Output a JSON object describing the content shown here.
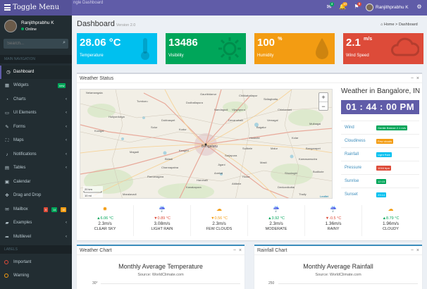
{
  "header": {
    "brand": "Toggle Menu",
    "tab_title": "ngle Dashboard",
    "notifications": [
      {
        "icon": "envelope-icon",
        "count": "4",
        "color": "#00a65a"
      },
      {
        "icon": "bell-icon",
        "count": "10",
        "color": "#f39c12"
      },
      {
        "icon": "flag-icon",
        "count": "9",
        "color": "#dd4b39"
      }
    ],
    "user_name": "Ranjithprabhu K",
    "settings_icon": "gears-icon"
  },
  "sidebar": {
    "user_name": "Ranjithprabhu K",
    "status": "Online",
    "search_placeholder": "Search...",
    "nav_header": "MAIN NAVIGATION",
    "items": [
      {
        "label": "Dashboard",
        "icon": "dashboard-icon",
        "active": true
      },
      {
        "label": "Widgets",
        "icon": "th-icon",
        "badge": "new",
        "badge_color": "#00a65a"
      },
      {
        "label": "Charts",
        "icon": "pie-chart-icon"
      },
      {
        "label": "UI Elements",
        "icon": "laptop-icon"
      },
      {
        "label": "Forms",
        "icon": "edit-icon"
      },
      {
        "label": "Maps",
        "icon": "map-icon"
      },
      {
        "label": "Notifications",
        "icon": "bell-icon"
      },
      {
        "label": "Tables",
        "icon": "table-icon"
      },
      {
        "label": "Calendar",
        "icon": "calendar-icon"
      },
      {
        "label": "Drag and Drop",
        "icon": "drag-icon"
      },
      {
        "label": "Mailbox",
        "icon": "envelope-icon",
        "badges": [
          {
            "text": "5",
            "color": "#dd4b39"
          },
          {
            "text": "14",
            "color": "#00a65a"
          },
          {
            "text": "16",
            "color": "#f39c12"
          }
        ]
      },
      {
        "label": "Examples",
        "icon": "folder-icon"
      },
      {
        "label": "Multilevel",
        "icon": "share-icon"
      }
    ],
    "labels_header": "LABELS",
    "labels": [
      {
        "label": "Important",
        "color": "#dd4b39"
      },
      {
        "label": "Warning",
        "color": "#f39c12"
      }
    ]
  },
  "page": {
    "title": "Dashboard",
    "version": "Version 2.0",
    "breadcrumb_home": "Home",
    "breadcrumb_current": "Dashboard"
  },
  "tiles": [
    {
      "value": "28.06 °C",
      "label": "Temperature",
      "color": "#00c0ef",
      "icon": "thermometer-icon"
    },
    {
      "value": "13486",
      "label": "Visibility",
      "color": "#00a65a",
      "icon": "sun-icon"
    },
    {
      "value": "100",
      "unit": "%",
      "label": "Humidity",
      "color": "#f39c12",
      "icon": "drop-icon"
    },
    {
      "value": "2.1",
      "unit": "m/s",
      "label": "Wind Speed",
      "color": "#dd4b39",
      "icon": "cloud-icon"
    }
  ],
  "weather": {
    "box_title": "Weather Status",
    "location_title": "Weather in Bangalore, IN",
    "time": "01 : 44 : 00 PM",
    "rows": [
      {
        "key": "Wind",
        "value": "Gentle Breeze 2.1 m/s",
        "color": "#00a65a"
      },
      {
        "key": "Cloudiness",
        "value": "Few clouds",
        "color": "#f39c12"
      },
      {
        "key": "Rainfall",
        "value": "Light Rain",
        "color": "#00c0ef"
      },
      {
        "key": "Pressure",
        "value": "1016 hpa",
        "color": "#dd4b39"
      },
      {
        "key": "Sunrise",
        "value": "12:15",
        "color": "#00a65a"
      },
      {
        "key": "Sunset",
        "value": "23:14",
        "color": "#00c0ef"
      }
    ],
    "map": {
      "city": "Bengaluru",
      "scale_km": "20 km",
      "scale_mi": "10 mi",
      "attribution": "Leaflet",
      "places": [
        "Nelamangala",
        "Tumkuru",
        "Dodballapura",
        "Devanahalli",
        "Hoskote",
        "Kolar",
        "Magadi",
        "Ramanagara",
        "Kanakapura",
        "Anekal",
        "Hosur",
        "Malur",
        "Bangarapet",
        "Chintamani",
        "Sarjapura",
        "Bidadi",
        "Kunigal",
        "Channapatna",
        "Denkanikottai",
        "Thally",
        "Vijayapura",
        "Sidlaghatta",
        "Gauribidanur",
        "Mulbagal",
        "Kengeri",
        "Jigani",
        "Attibele",
        "Solur",
        "Huliyurdurga",
        "Dobbaspet",
        "Kudur",
        "Chikkaballapur",
        "Vemagal",
        "Masti",
        "Sulibele",
        "Nandagudi",
        "Harohalli",
        "Maralavadi",
        "Bagalur",
        "Shoolagiri",
        "Kamasamudra",
        "Budikote"
      ]
    },
    "forecast": [
      {
        "icon": "sun-icon",
        "icon_color": "#f39c12",
        "temp": "▲6.06 °C",
        "temp_color": "#00a65a",
        "wind": "2.3m/s",
        "cond": "CLEAR SKY"
      },
      {
        "icon": "rain-icon",
        "icon_color": "#3c8dbc",
        "temp": "▼0.89 °C",
        "temp_color": "#dd4b39",
        "wind": "3.08m/s",
        "cond": "LIGHT RAIN"
      },
      {
        "icon": "cloud-icon",
        "icon_color": "#f39c12",
        "temp": "▼0.56 °C",
        "temp_color": "#f39c12",
        "wind": "2.3m/s",
        "cond": "FEW CLOUDS"
      },
      {
        "icon": "rain-icon",
        "icon_color": "#dd4b39",
        "temp": "▲3.92 °C",
        "temp_color": "#00a65a",
        "wind": "2.3m/s",
        "cond": "MODERATE"
      },
      {
        "icon": "rain-icon",
        "icon_color": "#3c8dbc",
        "temp": "▼-0.5 °C",
        "temp_color": "#dd4b39",
        "wind": "1.36m/s",
        "cond": "RAINY"
      },
      {
        "icon": "cloud-icon",
        "icon_color": "#f39c12",
        "temp": "▲8.79 °C",
        "temp_color": "#00a65a",
        "wind": "1.96m/s",
        "cond": "CLOUDY"
      }
    ]
  },
  "charts": [
    {
      "box_title": "Weather Chart",
      "title": "Monthly Average Temperature",
      "subtitle": "Source: WorldClimate.com",
      "first_tick": "30°"
    },
    {
      "box_title": "Rainfall Chart",
      "title": "Monthly Average Rainfall",
      "subtitle": "Source: WorldClimate.com",
      "first_tick": "250"
    }
  ]
}
